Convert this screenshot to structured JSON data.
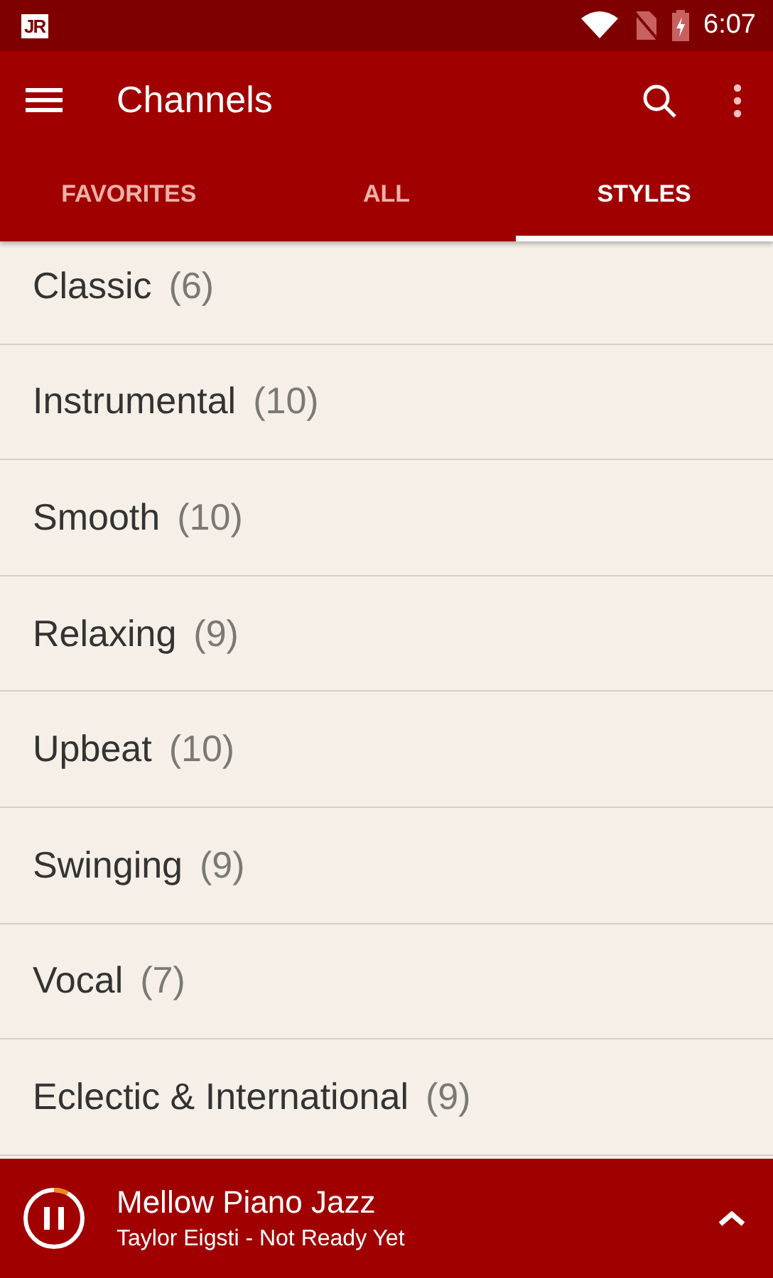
{
  "status_bar": {
    "app_badge": "JR",
    "time": "6:07"
  },
  "toolbar": {
    "title": "Channels"
  },
  "tabs": [
    {
      "label": "FAVORITES",
      "selected": false
    },
    {
      "label": "ALL",
      "selected": false
    },
    {
      "label": "STYLES",
      "selected": true
    }
  ],
  "styles": [
    {
      "name": "Classic",
      "count": "(6)"
    },
    {
      "name": "Instrumental",
      "count": "(10)"
    },
    {
      "name": "Smooth",
      "count": "(10)"
    },
    {
      "name": "Relaxing",
      "count": "(9)"
    },
    {
      "name": "Upbeat",
      "count": "(10)"
    },
    {
      "name": "Swinging",
      "count": "(9)"
    },
    {
      "name": "Vocal",
      "count": "(7)"
    },
    {
      "name": "Eclectic & International",
      "count": "(9)"
    }
  ],
  "player": {
    "channel": "Mellow Piano Jazz",
    "track": "Taylor Eigsti - Not Ready Yet",
    "playing": true,
    "level": 0.08
  }
}
